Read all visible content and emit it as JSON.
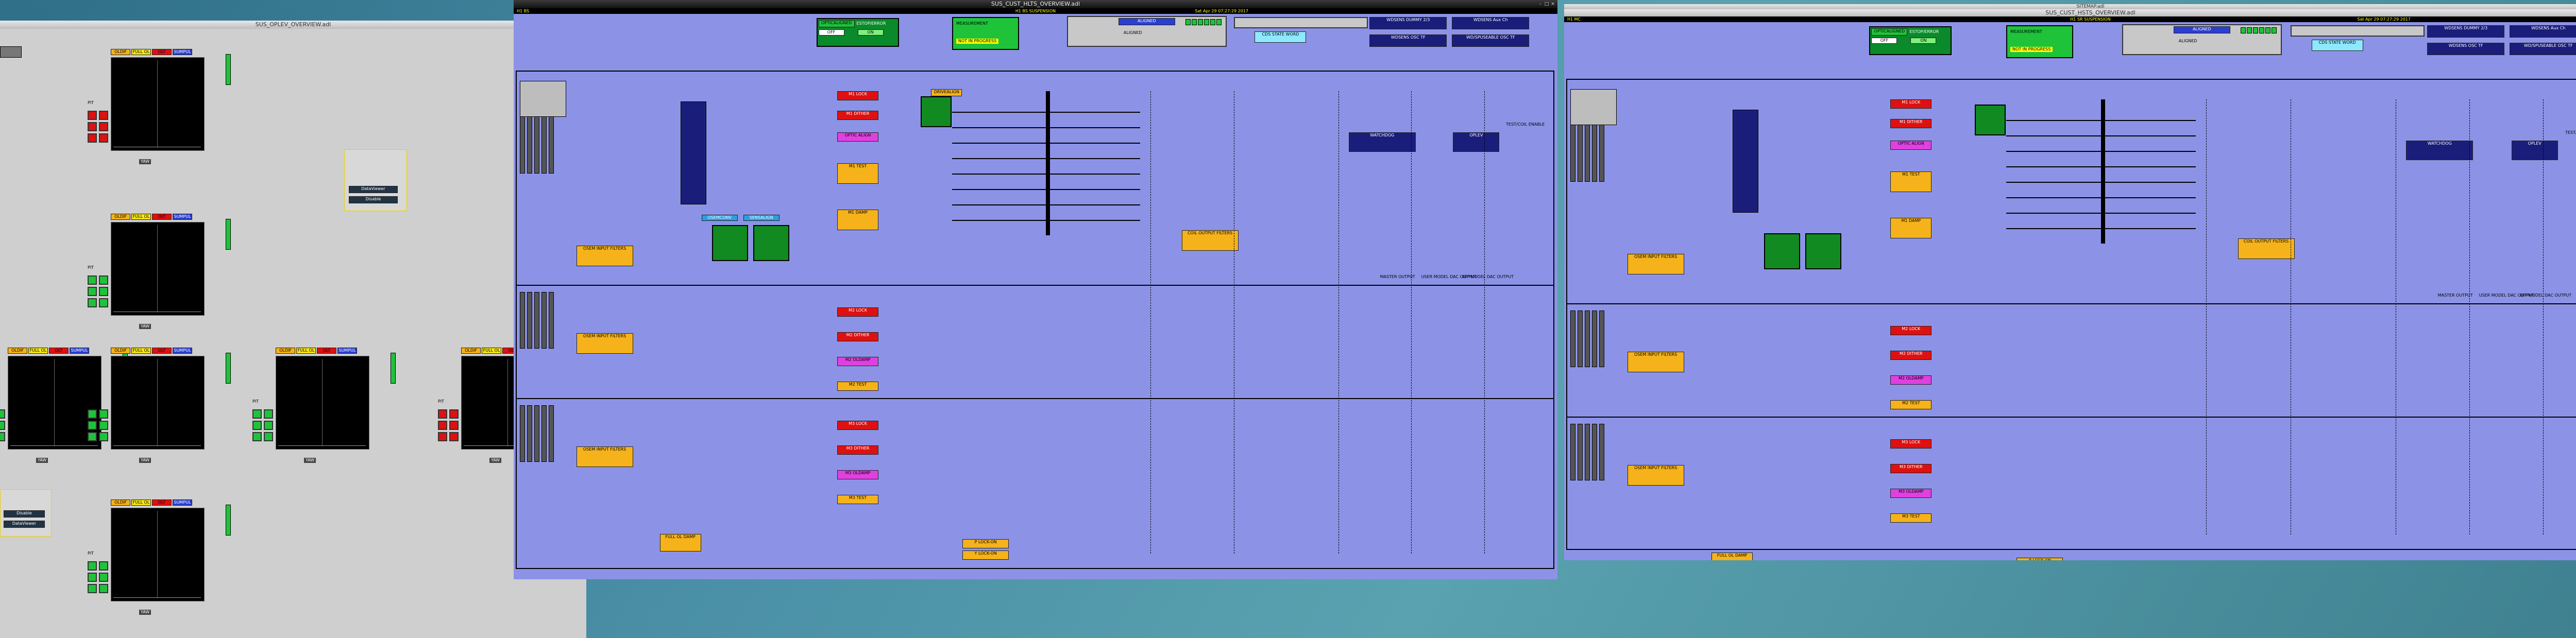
{
  "windows": {
    "oplev": {
      "title": "SUS_OPLEV_OVERVIEW.adl",
      "panels": [
        {
          "tags": [
            "OLDIF",
            "FULL OL",
            "OLT",
            "SUMPUL"
          ]
        },
        {
          "tags": [
            "OLDIF",
            "FULL OL",
            "OLT",
            "SUMPUL"
          ]
        },
        {
          "tags": [
            "OLDIF",
            "FULL OL",
            "OLT",
            "SUMPUL"
          ]
        },
        {
          "tags": [
            "OLDIF",
            "FULL OL",
            "OLT",
            "SUMPUL"
          ]
        },
        {
          "tags": [
            "OLDIF",
            "FULL OL",
            "OLT",
            "SUMPUL"
          ]
        },
        {
          "tags": [
            "OLDIF",
            "FULL OL",
            "OLT",
            "SUMPUL"
          ]
        }
      ],
      "labels": {
        "pit": "PIT",
        "yaw": "YAW",
        "disable": "Disable",
        "damp": "DataViewer"
      }
    },
    "hlts": {
      "title": "SUS_CUST_HLTS_OVERVIEW.adl",
      "header_left": "H1 BS",
      "header_center": "H1 BS SUSPENSION",
      "header_time": "Sat Apr 29 07:27:29 2017",
      "guardian": {
        "optic": "OPTICALIGNED",
        "state": "ESTOP/ERROR",
        "off": "OFF",
        "on": "ON"
      },
      "measurement": {
        "label": "MEASUREMENT",
        "status": "NOT IN PROGRESS"
      },
      "aligned": {
        "label": "ALIGNED",
        "sub": "ALIGNED"
      },
      "top_buttons": [
        "WDSENS DUMMY 2/3",
        "WDSENS Aux Ch",
        "WDSENS OSC TF",
        "WD/SPUSEABLE OSC TF"
      ],
      "cds_state": "CDS STATE WORD",
      "stage_labels": [
        "M1",
        "M2",
        "M3"
      ],
      "lock_buttons": [
        "M1 LOCK",
        "M1 DITHER",
        "OPTIC ALIGN",
        "M1 TEST",
        "M1 DAMP"
      ],
      "m2_buttons": [
        "M2 LOCK",
        "M2 DITHER",
        "M2 OLDAMP",
        "M2 TEST"
      ],
      "m3_buttons": [
        "M3 LOCK",
        "M3 DITHER",
        "M3 OLDAMP",
        "M3 TEST"
      ],
      "filters": [
        "OSEM INPUT FILTERS",
        "COIL OUTPUT FILTERS"
      ],
      "osemconv": "OSEMCONV",
      "drivealign": "DRIVEALIGN",
      "sensalign": "SENSALIGN",
      "watchdog": "WATCHDOG",
      "oplev": "OPLEV",
      "bottom_labels": [
        "MASTER OUTPUT",
        "USER MODEL DAC OUTPUT",
        "DIP MODEL DAC OUTPUT"
      ],
      "full_ol": "FULL OL DAMP",
      "ylock": [
        "P LOCK-ON",
        "Y LOCK-ON"
      ],
      "test_enable": "TEST/COIL ENABLE"
    },
    "sitemap": {
      "title": "SITEMAP.adl"
    },
    "hsts": {
      "title": "SUS_CUST_HSTS_OVERVIEW.adl",
      "header_left": "H1 MC",
      "header_center": "H1 SR SUSPENSION",
      "header_time": "Sat Apr 29 07:27:29 2017",
      "guardian": {
        "optic": "OPTICALIGNED",
        "state": "ESTOP/ERROR",
        "off": "OFF",
        "on": "ON"
      },
      "measurement": {
        "label": "MEASUREMENT",
        "status": "NOT IN PROGRESS"
      },
      "aligned": {
        "label": "ALIGNED",
        "sub": "ALIGNED"
      },
      "top_buttons": [
        "WDSENS DUMMY 2/3",
        "WDSENS Aux Ch",
        "WDSENS OSC TF",
        "WD/SPUSEABLE OSC TF"
      ],
      "cds_state": "CDS STATE WORD",
      "lock_buttons": [
        "M1 LOCK",
        "M1 DITHER",
        "OPTIC ALIGN",
        "M1 TEST",
        "M1 DAMP"
      ],
      "m2_buttons": [
        "M2 LOCK",
        "M2 DITHER",
        "M2 OLDAMP",
        "M2 TEST"
      ],
      "m3_buttons": [
        "M3 LOCK",
        "M3 DITHER",
        "M3 OLDAMP",
        "M3 TEST"
      ],
      "filters": [
        "OSEM INPUT FILTERS",
        "COIL OUTPUT FILTERS"
      ],
      "watchdog": "WATCHDOG",
      "oplev": "OPLEV",
      "bottom_labels": [
        "MASTER OUTPUT",
        "USER MODEL DAC OUTPUT",
        "DIP MODEL DAC OUTPUT"
      ],
      "full_ol": "FULL OL DAMP",
      "ylock": [
        "P LOCK-ON",
        "Y LOCK-ON"
      ],
      "test_enable": "TEST/COIL ENABLE"
    }
  }
}
